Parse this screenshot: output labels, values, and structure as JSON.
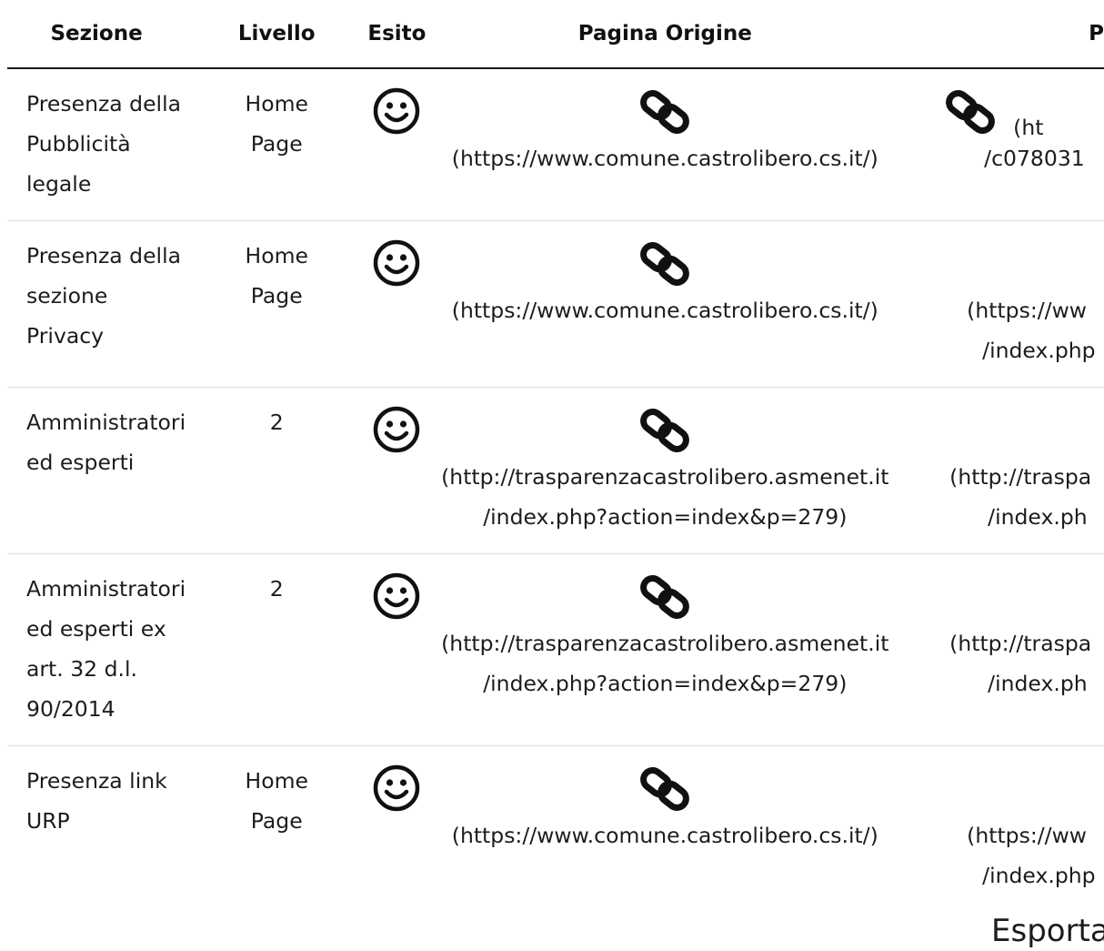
{
  "headers": {
    "sezione": "Sezione",
    "livello": "Livello",
    "esito": "Esito",
    "pagina_origine": "Pagina Origine",
    "pagina_destinazione": "P"
  },
  "rows": [
    {
      "sezione": [
        "Presenza della",
        "Pubblicità",
        "legale"
      ],
      "livello": [
        "Home",
        "Page"
      ],
      "esito_icon": "smiley-icon",
      "origine": [
        "(https://www.comune.castrolibero.cs.it/)"
      ],
      "destinazione": [
        "(ht",
        "/c078031"
      ]
    },
    {
      "sezione": [
        "Presenza della",
        "sezione",
        "Privacy"
      ],
      "livello": [
        "Home",
        "Page"
      ],
      "esito_icon": "smiley-icon",
      "origine": [
        "(https://www.comune.castrolibero.cs.it/)"
      ],
      "destinazione": [
        "(https://ww",
        "/index.php"
      ]
    },
    {
      "sezione": [
        "Amministratori",
        "ed esperti"
      ],
      "livello": [
        "2"
      ],
      "esito_icon": "smiley-icon",
      "origine": [
        "(http://trasparenzacastrolibero.asmenet.it",
        "/index.php?action=index&p=279)"
      ],
      "destinazione": [
        "(http://traspa",
        "/index.ph"
      ]
    },
    {
      "sezione": [
        "Amministratori",
        "ed esperti ex",
        "art. 32 d.l.",
        "90/2014"
      ],
      "livello": [
        "2"
      ],
      "esito_icon": "smiley-icon",
      "origine": [
        "(http://trasparenzacastrolibero.asmenet.it",
        "/index.php?action=index&p=279)"
      ],
      "destinazione": [
        "(http://traspa",
        "/index.ph"
      ]
    },
    {
      "sezione": [
        "Presenza link",
        "URP"
      ],
      "livello": [
        "Home",
        "Page"
      ],
      "esito_icon": "smiley-icon",
      "origine": [
        "(https://www.comune.castrolibero.cs.it/)"
      ],
      "destinazione": [
        "(https://ww",
        "/index.php"
      ]
    }
  ],
  "export_label": "Esporta"
}
